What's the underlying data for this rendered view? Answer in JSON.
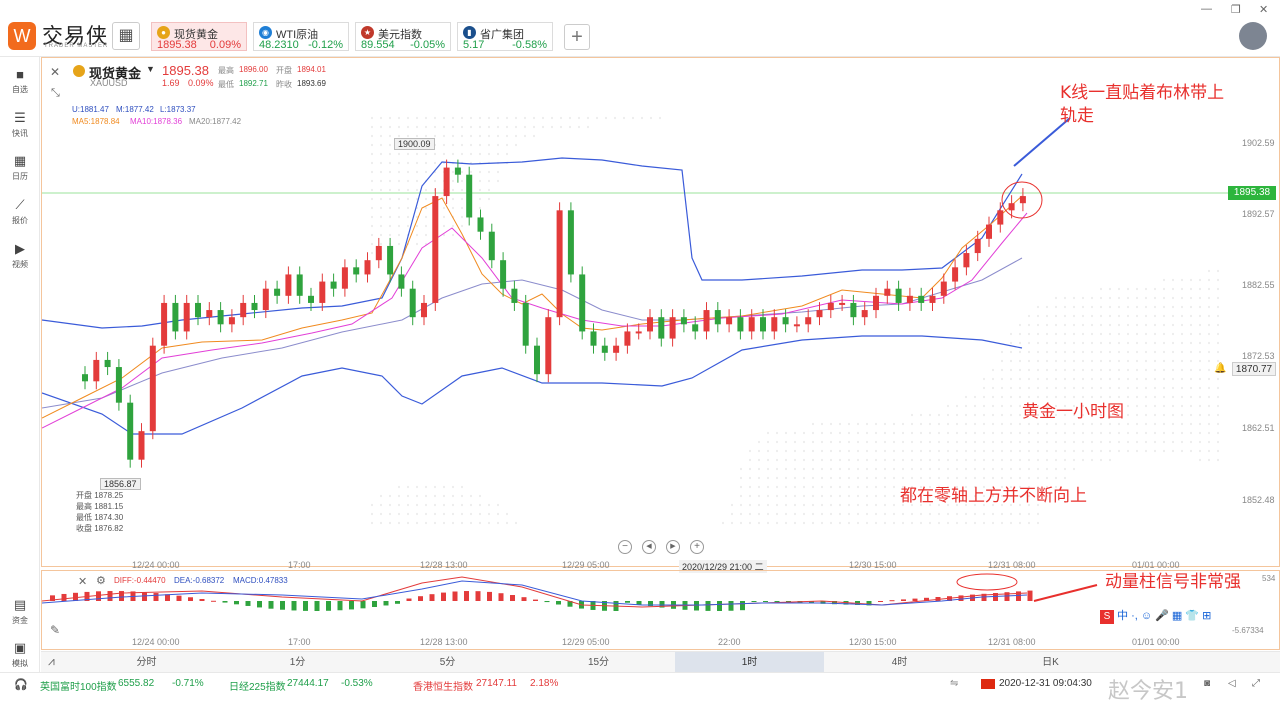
{
  "app": {
    "brand": "交易侠",
    "brand_sub": "TRADER MASTER"
  },
  "quote_tabs": [
    {
      "name": "现货黄金",
      "price": "1895.38",
      "change": "0.09%",
      "icon": "gold-coin-icon",
      "color": "#e33b3b"
    },
    {
      "name": "WTI原油",
      "price": "48.2310",
      "change": "-0.12%",
      "icon": "oil-icon",
      "color": "#1f9f4a"
    },
    {
      "name": "美元指数",
      "price": "89.554",
      "change": "-0.05%",
      "icon": "us-flag-icon",
      "color": "#1f9f4a"
    },
    {
      "name": "省广集团",
      "price": "5.17",
      "change": "-0.58%",
      "icon": "stock-icon",
      "color": "#1f9f4a"
    }
  ],
  "sidebar": [
    {
      "label": "自选",
      "icon": "bookmark-icon"
    },
    {
      "label": "快讯",
      "icon": "news-icon"
    },
    {
      "label": "日历",
      "icon": "calendar-icon"
    },
    {
      "label": "报价",
      "icon": "trend-icon"
    },
    {
      "label": "视频",
      "icon": "play-icon"
    }
  ],
  "sidebar_bottom": [
    {
      "label": "资金"
    },
    {
      "label": "模拟"
    }
  ],
  "symbol": {
    "name": "现货黄金",
    "code": "XAUUSD",
    "price": "1895.38",
    "change": "1.69",
    "change_pct": "0.09%",
    "high_label": "最高",
    "high": "1896.00",
    "open_label": "开盘",
    "open": "1894.01",
    "low_label": "最低",
    "low": "1892.71",
    "prev_label": "昨收",
    "prev": "1893.69"
  },
  "indicators": {
    "boll": [
      "U:1881.47",
      "M:1877.42",
      "L:1873.37"
    ],
    "ma": [
      "MA5:1878.84",
      "MA10:1878.36",
      "MA20:1877.42"
    ]
  },
  "callouts": {
    "high_value": "1900.09",
    "low_value": "1856.87",
    "ohlc": [
      "开盘 1878.25",
      "最高 1881.15",
      "最低 1874.30",
      "收盘 1876.82"
    ]
  },
  "price_axis": [
    "1902.59",
    "1892.57",
    "1882.55",
    "1872.53",
    "1862.51",
    "1852.48"
  ],
  "last_price_tag": "1895.38",
  "cursor_price_tag": "1870.77",
  "time_axis": [
    "12/24 00:00",
    "17:00",
    "12/28 13:00",
    "12/29 05:00",
    "12/30 15:00",
    "12/31 08:00",
    "01/01 00:00"
  ],
  "cursor_time": "2020/12/29 21:00 二",
  "macd_axis": [
    "12/24 00:00",
    "17:00",
    "12/28 13:00",
    "12/29 05:00",
    "22:00",
    "12/30 15:00",
    "12/31 08:00",
    "01/01 00:00"
  ],
  "macd_labels": {
    "diff": "DIFF:-0.44470",
    "dea": "DEA:-0.68372",
    "macd": "MACD:0.47833"
  },
  "macd_axis_values": [
    "534",
    "-5.67334"
  ],
  "periods": [
    "分时",
    "1分",
    "5分",
    "15分",
    "1时",
    "4时",
    "日K"
  ],
  "active_period": "1时",
  "annotations": {
    "k_line": "K线一直贴着布林带上轨走",
    "chart_type": "黄金一小时图",
    "zero_axis": "都在零轴上方并不断向上",
    "momentum": "动量柱信号非常强"
  },
  "status": [
    {
      "name": "英国富时100指数",
      "value": "6555.82",
      "change": "-0.71%"
    },
    {
      "name": "日经225指数",
      "value": "27444.17",
      "change": "-0.53%"
    },
    {
      "name": "香港恒生指数",
      "value": "27147.11",
      "change": "2.18%"
    }
  ],
  "datetime": "2020-12-31 09:04:30",
  "watermark": "赵今安1",
  "toolbar_text": "中"
}
